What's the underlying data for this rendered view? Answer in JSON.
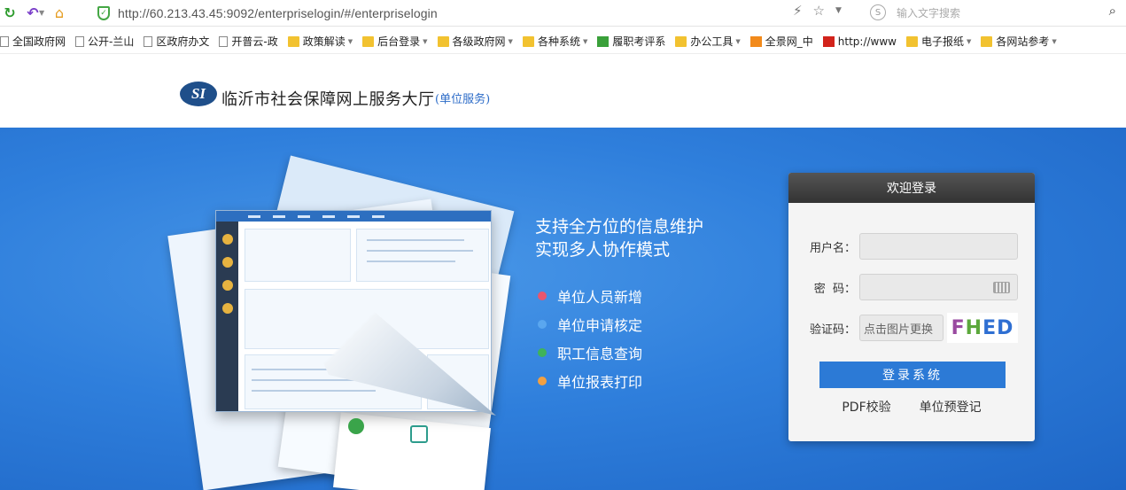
{
  "browser": {
    "url": "http://60.213.43.45:9092/enterpriselogin/#/enterpriselogin",
    "search_placeholder": "输入文字搜索",
    "bookmarks": [
      {
        "label": "全国政府网",
        "icon": "page"
      },
      {
        "label": "公开-兰山",
        "icon": "page"
      },
      {
        "label": "区政府办文",
        "icon": "page"
      },
      {
        "label": "开普云-政",
        "icon": "page"
      },
      {
        "label": "政策解读",
        "icon": "folder",
        "dropdown": true
      },
      {
        "label": "后台登录",
        "icon": "folder",
        "dropdown": true
      },
      {
        "label": "各级政府网",
        "icon": "folder",
        "dropdown": true
      },
      {
        "label": "各种系统",
        "icon": "folder",
        "dropdown": true
      },
      {
        "label": "履职考评系",
        "icon": "green"
      },
      {
        "label": "办公工具",
        "icon": "folder",
        "dropdown": true
      },
      {
        "label": "全景网_中",
        "icon": "orange"
      },
      {
        "label": "http://www",
        "icon": "red"
      },
      {
        "label": "电子报纸",
        "icon": "folder",
        "dropdown": true
      },
      {
        "label": "各网站参考",
        "icon": "folder",
        "dropdown": true
      }
    ]
  },
  "site": {
    "logo_text": "SI",
    "title": "临沂市社会保障网上服务大厅",
    "subtitle": "(单位服务)"
  },
  "banner": {
    "headline_1": "支持全方位的信息维护",
    "headline_2": "实现多人协作模式",
    "features": [
      {
        "label": "单位人员新增",
        "color": "#e8566e"
      },
      {
        "label": "单位申请核定",
        "color": "#5aa7ef"
      },
      {
        "label": "职工信息查询",
        "color": "#3fb35a"
      },
      {
        "label": "单位报表打印",
        "color": "#f2a042"
      }
    ]
  },
  "login": {
    "header": "欢迎登录",
    "username_label": "用户名：",
    "username_value": "",
    "password_label": "密  码：",
    "password_value": "",
    "captcha_label": "验证码：",
    "captcha_placeholder": "点击图片更换",
    "captcha_text": [
      "F",
      "H",
      "E",
      "D"
    ],
    "login_button": "登录系统",
    "pdf_link": "PDF校验",
    "preregister_link": "单位预登记"
  }
}
